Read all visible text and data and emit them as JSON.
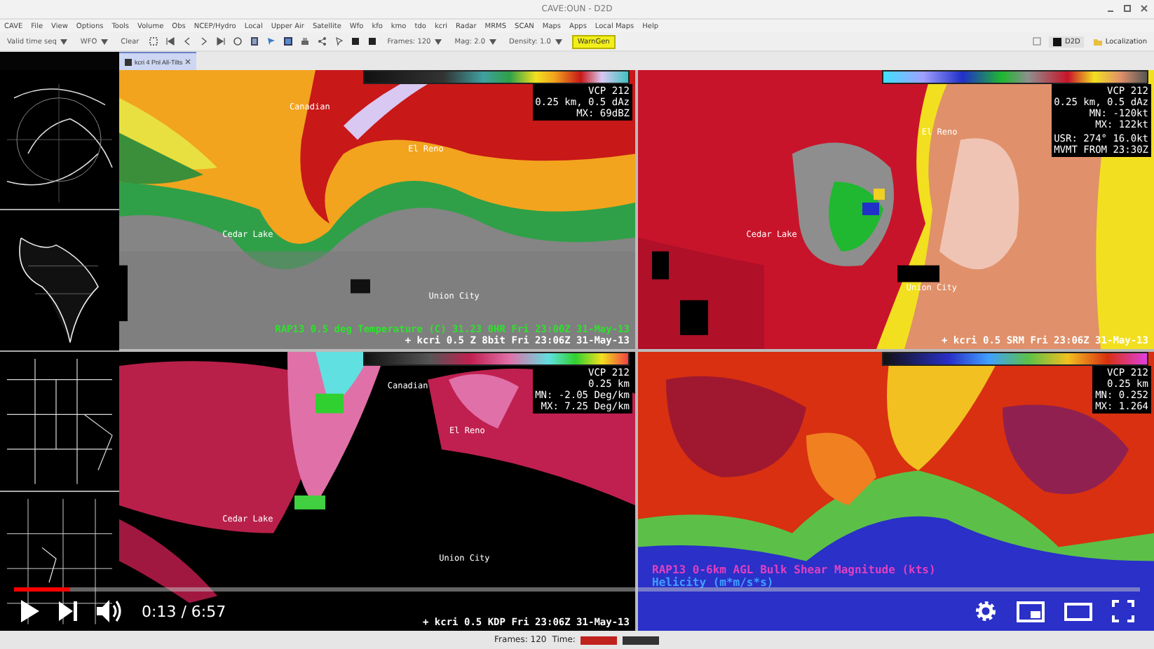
{
  "window": {
    "title": "CAVE:OUN - D2D"
  },
  "menu": [
    "CAVE",
    "File",
    "View",
    "Options",
    "Tools",
    "Volume",
    "Obs",
    "NCEP/Hydro",
    "Local",
    "Upper Air",
    "Satellite",
    "Wfo",
    "kfo",
    "kmo",
    "tdo",
    "kcri",
    "Radar",
    "MRMS",
    "SCAN",
    "Maps",
    "Apps",
    "Local Maps",
    "Help"
  ],
  "toolbar": {
    "time_mode": "Valid time seq",
    "scale": "WFO",
    "clear": "Clear",
    "frames": "Frames: 120",
    "mag": "Mag: 2.0",
    "density": "Density: 1.0",
    "warngen": "WarnGen",
    "perspective": "D2D",
    "localization": "Localization"
  },
  "tabs": [
    {
      "label": "kcri 4 Pnl All-Tilts",
      "selected": true
    }
  ],
  "panes": [
    {
      "kind": "reflectivity",
      "info": [
        "VCP 212",
        "0.25 km, 0.5 dAz",
        "MX: 69dBZ"
      ],
      "places": [
        "Canadian",
        "El Reno",
        "Cedar Lake",
        "Union City"
      ],
      "legend": [
        {
          "text": "RAP13 0.5 deg Temperature  (C)     31.23   0HR Fri 23:00Z 31-May-13",
          "color": "#30e030"
        },
        {
          "text": "+ kcri 0.5  Z 8bit  Fri 23:06Z 31-May-13",
          "color": "#ffffff"
        }
      ]
    },
    {
      "kind": "velocity",
      "info": [
        "VCP 212",
        "0.25 km, 0.5 dAz",
        "MN: -120kt",
        "MX: 122kt"
      ],
      "extra_info": [
        "USR: 274° 16.0kt",
        "MVMT FROM 23:30Z"
      ],
      "places": [
        "El Reno",
        "Cedar Lake",
        "Union City"
      ],
      "legend": [
        {
          "text": "+ kcri 0.5   SRM   Fri 23:06Z 31-May-13",
          "color": "#ffffff"
        }
      ]
    },
    {
      "kind": "kdp",
      "info": [
        "VCP 212",
        "0.25 km",
        "MN: -2.05 Deg/km",
        "MX: 7.25 Deg/km"
      ],
      "places": [
        "Canadian",
        "El Reno",
        "Cedar Lake",
        "Union City"
      ],
      "legend": [
        {
          "text": "+ kcri 0.5   KDP   Fri 23:06Z 31-May-13",
          "color": "#ffffff"
        }
      ]
    },
    {
      "kind": "shear",
      "info": [
        "VCP 212",
        "0.25 km",
        "MN: 0.252",
        "MX: 1.264"
      ],
      "legend": [
        {
          "text": "RAP13 0-6km AGL Bulk Shear Magnitude (kts)",
          "color": "#e040c0"
        },
        {
          "text": "Helicity (m*m/s*s)",
          "color": "#40a0ff"
        }
      ]
    }
  ],
  "status_bar": {
    "frames": "Frames: 120",
    "time_label": "Time:"
  },
  "player": {
    "paused": true,
    "level": 0.05,
    "time": "0:13 / 6:57"
  }
}
